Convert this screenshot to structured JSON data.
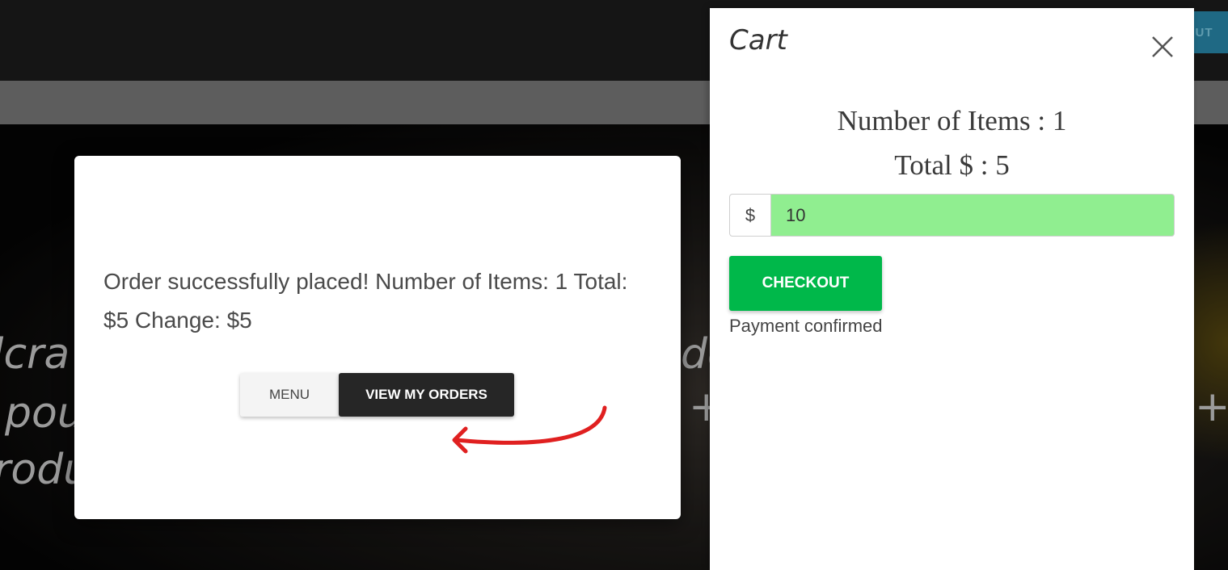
{
  "header": {
    "right_button_fragment": "UT"
  },
  "hero": {
    "line1_fragment": "lcra",
    "line2_fragment": "pou",
    "line3_fragment": "rodu",
    "right_fragment": "de"
  },
  "order_modal": {
    "message": "Order successfully placed! Number of Items: 1 Total: $5 Change: $5",
    "menu_label": "MENU",
    "view_orders_label": "VIEW MY ORDERS"
  },
  "cart": {
    "title": "Cart",
    "items_line": "Number of Items : 1",
    "total_line": "Total $ : 5",
    "currency_symbol": "$",
    "amount_value": "10",
    "checkout_label": "CHECKOUT",
    "status_text": "Payment confirmed"
  },
  "colors": {
    "checkout": "#00b84a",
    "amount_field": "#90ee90",
    "view_orders_bg": "#262626",
    "annotation_arrow": "#e02020"
  }
}
